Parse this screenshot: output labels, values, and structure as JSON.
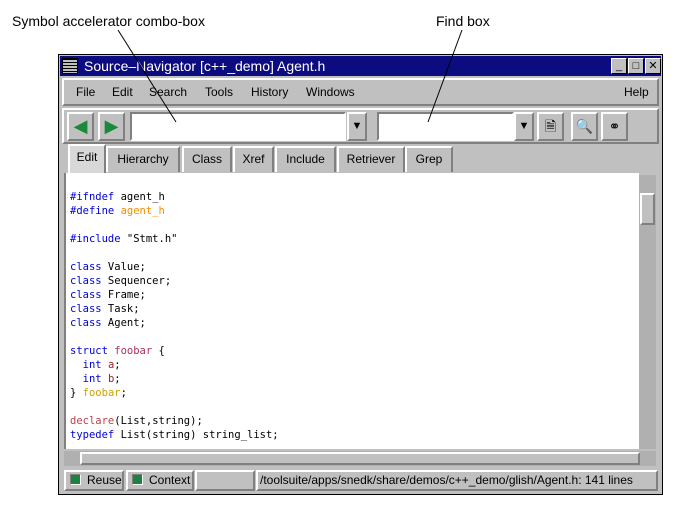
{
  "annotations": {
    "combo": "Symbol accelerator combo-box",
    "find": "Find box"
  },
  "window": {
    "title": "Source–Navigator [c++_demo] Agent.h"
  },
  "menu": [
    "File",
    "Edit",
    "Search",
    "Tools",
    "History",
    "Windows",
    "Help"
  ],
  "toolbar": {
    "symbol_value": "",
    "find_value": ""
  },
  "tabs": [
    "Edit",
    "Hierarchy",
    "Class",
    "Xref",
    "Include",
    "Retriever",
    "Grep"
  ],
  "code": [
    [
      [
        "#ifndef",
        "kw"
      ],
      [
        " agent_h",
        ""
      ]
    ],
    [
      [
        "#define",
        "kw"
      ],
      [
        " ",
        ""
      ],
      [
        "agent_h",
        "or"
      ]
    ],
    [],
    [
      [
        "#include",
        "kw"
      ],
      [
        " \"Stmt.h\"",
        ""
      ]
    ],
    [],
    [
      [
        "class",
        "kw"
      ],
      [
        " Value;",
        ""
      ]
    ],
    [
      [
        "class",
        "kw"
      ],
      [
        " Sequencer;",
        ""
      ]
    ],
    [
      [
        "class",
        "kw"
      ],
      [
        " Frame;",
        ""
      ]
    ],
    [
      [
        "class",
        "kw"
      ],
      [
        " Task;",
        ""
      ]
    ],
    [
      [
        "class",
        "kw"
      ],
      [
        " Agent;",
        ""
      ]
    ],
    [],
    [
      [
        "struct",
        "kw"
      ],
      [
        " ",
        ""
      ],
      [
        "foobar",
        "mg"
      ],
      [
        " {",
        ""
      ]
    ],
    [
      [
        "  ",
        ""
      ],
      [
        "int",
        "kw"
      ],
      [
        " ",
        ""
      ],
      [
        "a",
        "br"
      ],
      [
        ";",
        ""
      ]
    ],
    [
      [
        "  ",
        ""
      ],
      [
        "int",
        "kw"
      ],
      [
        " ",
        ""
      ],
      [
        "b",
        "br"
      ],
      [
        ";",
        ""
      ]
    ],
    [
      [
        "} ",
        ""
      ],
      [
        "foobar",
        "yl"
      ],
      [
        ";",
        ""
      ]
    ],
    [],
    [
      [
        "declare",
        "pk"
      ],
      [
        "(List,string);",
        ""
      ]
    ],
    [
      [
        "typedef",
        "kw"
      ],
      [
        " List(string) string_list;",
        ""
      ]
    ]
  ],
  "status": {
    "reuse": "Reuse",
    "context": "Context",
    "path": "/toolsuite/apps/snedk/share/demos/c++_demo/glish/Agent.h: 141 lines"
  }
}
